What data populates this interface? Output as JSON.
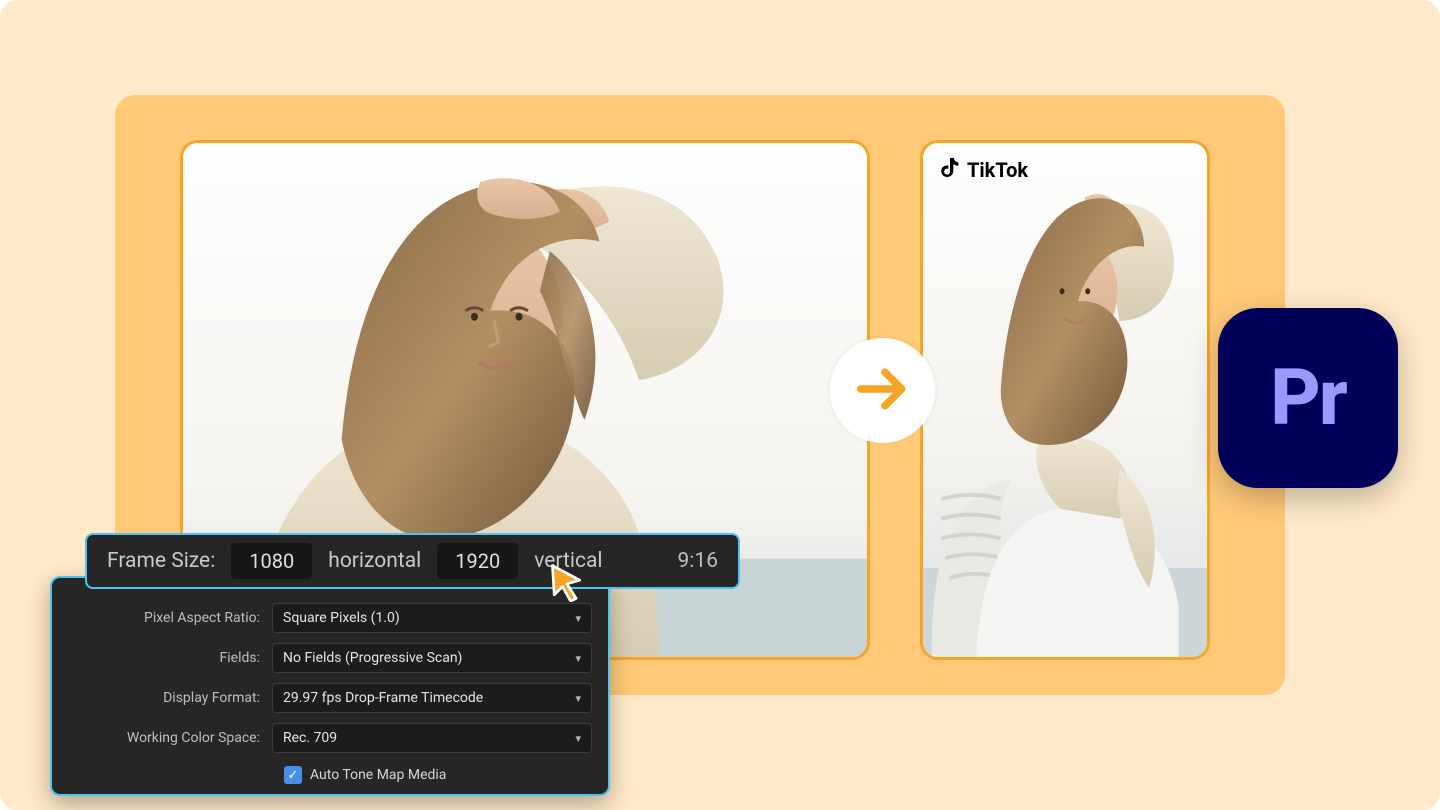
{
  "frameSize": {
    "label": "Frame Size:",
    "width": "1080",
    "widthLabel": "horizontal",
    "height": "1920",
    "heightLabel": "vertical",
    "ratio": "9:16"
  },
  "panel": {
    "rows": [
      {
        "label": "Pixel Aspect Ratio:",
        "value": "Square Pixels (1.0)"
      },
      {
        "label": "Fields:",
        "value": "No Fields (Progressive Scan)"
      },
      {
        "label": "Display Format:",
        "value": "29.97 fps Drop-Frame Timecode"
      },
      {
        "label": "Working Color Space:",
        "value": "Rec. 709"
      }
    ],
    "autoTone": {
      "checked": true,
      "label": "Auto Tone Map Media"
    }
  },
  "tiktok": {
    "label": "TikTok"
  },
  "pr": {
    "label": "Pr"
  }
}
